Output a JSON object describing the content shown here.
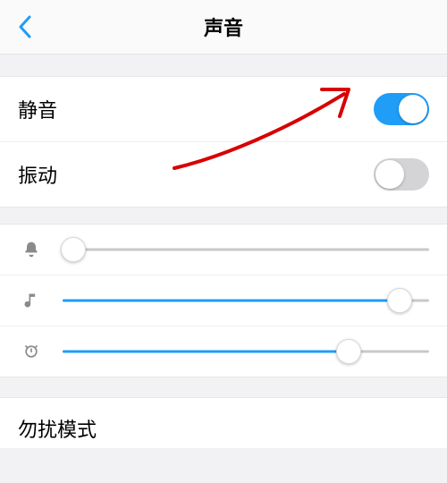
{
  "header": {
    "title": "声音"
  },
  "toggles": {
    "mute": {
      "label": "静音",
      "value": true
    },
    "vibrate": {
      "label": "振动",
      "value": false
    }
  },
  "sliders": {
    "ringer": {
      "icon": "bell-icon",
      "value": 3,
      "enabled": false
    },
    "media": {
      "icon": "music-icon",
      "value": 92,
      "enabled": true
    },
    "alarm": {
      "icon": "alarm-icon",
      "value": 78,
      "enabled": true
    }
  },
  "dnd": {
    "label": "勿扰模式"
  }
}
